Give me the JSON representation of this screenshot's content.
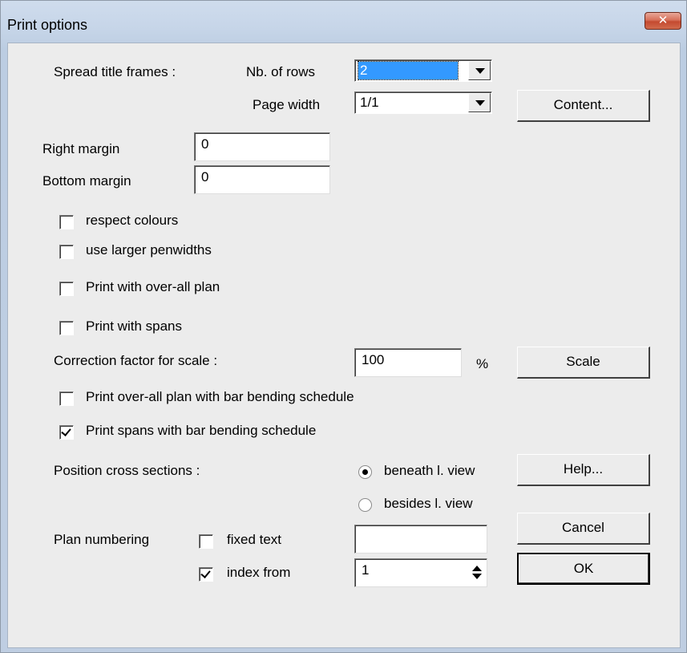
{
  "window": {
    "title": "Print options",
    "close_icon": "close-icon"
  },
  "spread": {
    "label": "Spread title frames :",
    "rows_label": "Nb. of rows",
    "rows_value": "2",
    "width_label": "Page width",
    "width_value": "1/1"
  },
  "margins": {
    "right_label": "Right margin",
    "right_value": "0",
    "bottom_label": "Bottom margin",
    "bottom_value": "0"
  },
  "checks": {
    "respect_colours": {
      "label": "respect colours",
      "checked": false
    },
    "larger_penwidths": {
      "label": "use larger penwidths",
      "checked": false
    },
    "overall_plan": {
      "label": "Print with over-all plan",
      "checked": false
    },
    "with_spans": {
      "label": "Print with spans",
      "checked": false
    },
    "overall_bending": {
      "label": "Print over-all plan with bar bending schedule",
      "checked": false
    },
    "spans_bending": {
      "label": "Print spans with bar bending schedule",
      "checked": true
    }
  },
  "scale": {
    "label": "Correction factor for scale :",
    "value": "100",
    "unit": "%"
  },
  "position": {
    "label": "Position cross sections :",
    "beneath": "beneath l. view",
    "besides": "besides l. view",
    "selected": "beneath"
  },
  "numbering": {
    "label": "Plan numbering",
    "fixed_text_label": "fixed text",
    "fixed_text_checked": false,
    "fixed_text_value": "",
    "index_label": "index from",
    "index_checked": true,
    "index_value": "1"
  },
  "buttons": {
    "content": "Content...",
    "scale": "Scale",
    "help": "Help...",
    "cancel": "Cancel",
    "ok": "OK"
  }
}
